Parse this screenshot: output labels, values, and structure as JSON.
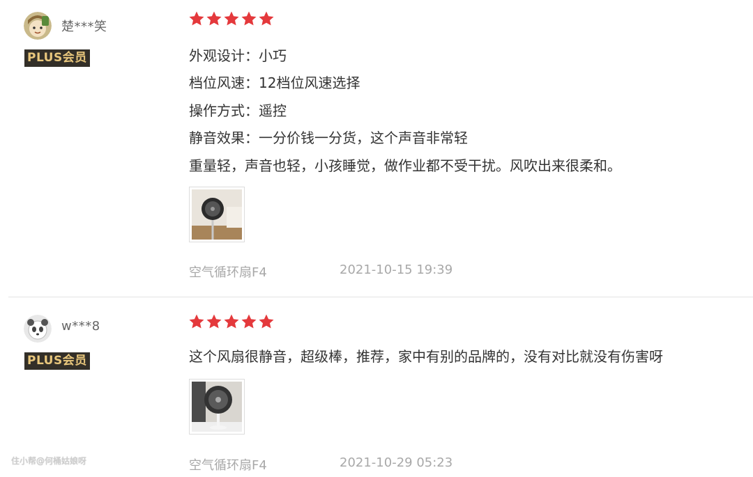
{
  "reviews": [
    {
      "username": "楚***笑",
      "badge": "PLUS会员",
      "rating": 5,
      "lines": [
        "外观设计：小巧",
        "档位风速：12档位风速选择",
        "操作方式：遥控",
        "静音效果：一分价钱一分货，这个声音非常轻",
        "重量轻，声音也轻，小孩睡觉，做作业都不受干扰。风吹出来很柔和。"
      ],
      "product": "空气循环扇F4",
      "date": "2021-10-15 19:39"
    },
    {
      "username": "w***8",
      "badge": "PLUS会员",
      "rating": 5,
      "lines": [
        "这个风扇很静音，超级棒，推荐，家中有别的品牌的，没有对比就没有伤害呀"
      ],
      "product": "空气循环扇F4",
      "date": "2021-10-29 05:23"
    }
  ],
  "watermark": "住小帮@何桶姑娘呀",
  "colors": {
    "star": "#e4393c",
    "badge_bg": "#332f28",
    "badge_text": "#e9c77c",
    "meta_text": "#a8a8a8"
  }
}
